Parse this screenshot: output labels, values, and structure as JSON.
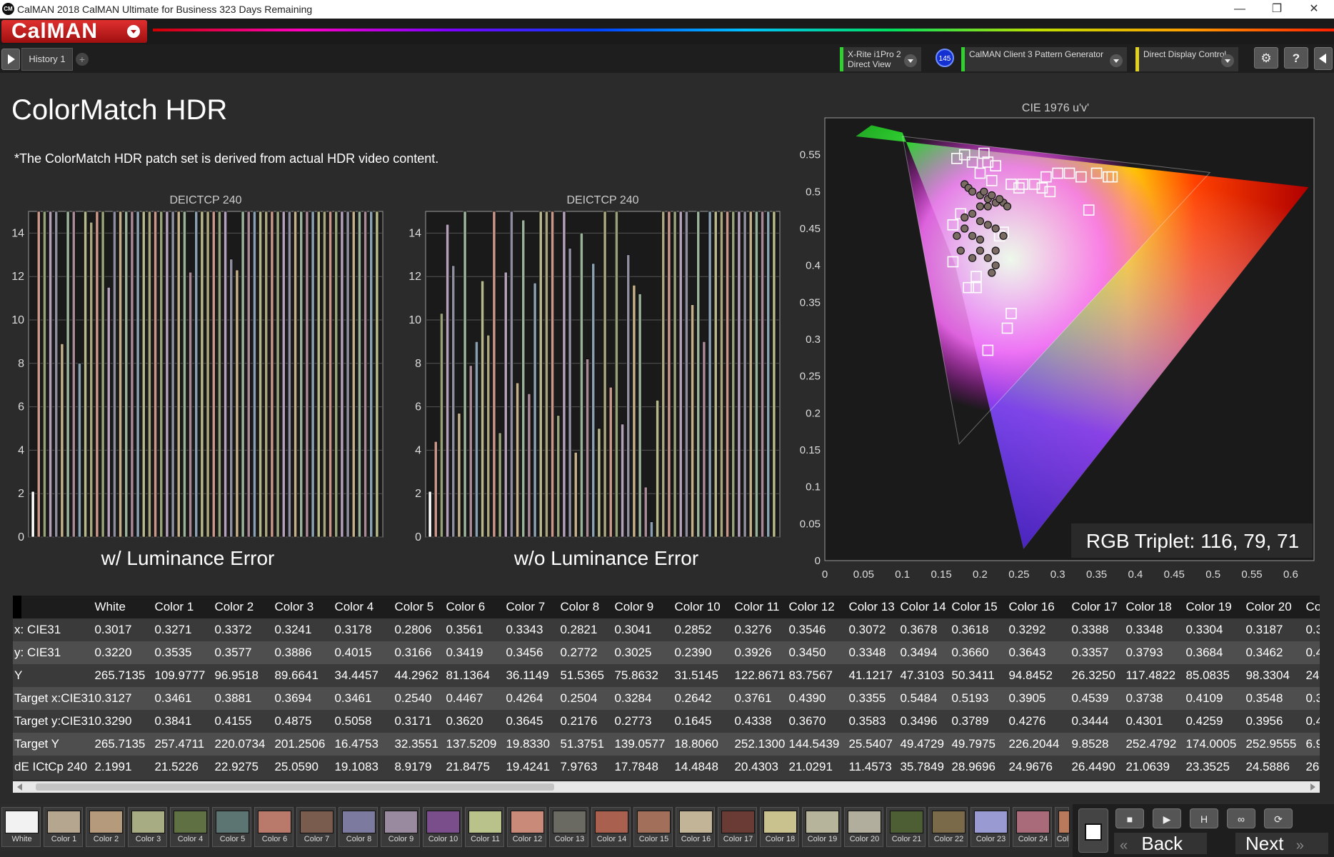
{
  "window": {
    "title": "CalMAN 2018 CalMAN Ultimate for Business 323 Days Remaining",
    "app_icon": "CM",
    "min": "—",
    "restore": "❐",
    "close": "✕"
  },
  "brand": {
    "logo": "CalMAN"
  },
  "toolbar": {
    "tab": "History 1",
    "add_tab": "+",
    "meter": {
      "line1": "X-Rite i1Pro 2",
      "line2": "Direct View"
    },
    "meter_badge": "145",
    "pattern_gen": "CalMAN Client 3 Pattern Generator",
    "display_ctrl": "Direct Display Control",
    "gear": "⚙",
    "help": "?"
  },
  "page": {
    "title": "ColorMatch HDR",
    "note": "*The ColorMatch HDR patch set is derived from actual HDR video content."
  },
  "chart_data": [
    {
      "type": "bar",
      "title": "DEICTCP 240",
      "caption": "w/ Luminance Error",
      "ylim": [
        0,
        15
      ],
      "yticks": [
        0,
        2,
        4,
        6,
        8,
        10,
        12,
        14
      ],
      "values": [
        2.1,
        21.5,
        22.9,
        25.1,
        19.1,
        8.9,
        21.8,
        19.4,
        8.0,
        17.8,
        14.5,
        20.4,
        21.0,
        11.5,
        35.8,
        29.0,
        25.0,
        26.4,
        21.1,
        23.4,
        24.6,
        22,
        24,
        26,
        21,
        30,
        18,
        12.2,
        19,
        25,
        22,
        21,
        27,
        24,
        12.8,
        12.3,
        20,
        23,
        21,
        22,
        28,
        19,
        22,
        24,
        23,
        25,
        18,
        22,
        24,
        21,
        26,
        20,
        23,
        25,
        22,
        19,
        24,
        21,
        23,
        20
      ]
    },
    {
      "type": "bar",
      "title": "DEICTCP 240",
      "caption": "w/o Luminance Error",
      "ylim": [
        0,
        15
      ],
      "yticks": [
        0,
        2,
        4,
        6,
        8,
        10,
        12,
        14
      ],
      "values": [
        2.1,
        4.4,
        10.3,
        14.4,
        12.5,
        5.7,
        16,
        7.9,
        9.0,
        11.8,
        9.3,
        20,
        4.8,
        12.2,
        20,
        7.1,
        14.6,
        6.6,
        11.7,
        18,
        20,
        17,
        5.6,
        15,
        13.3,
        3.9,
        14,
        8.2,
        12.6,
        5.0,
        16,
        6.9,
        19,
        5.2,
        13,
        11.6,
        11.2,
        2.3,
        0.7,
        6.3,
        20,
        18,
        22,
        19,
        16,
        10.7,
        21,
        9.0,
        20,
        22,
        17,
        25,
        21,
        19,
        23,
        20,
        18,
        24,
        22,
        21
      ]
    },
    {
      "type": "scatter",
      "title": "CIE 1976 u'v'",
      "xlim": [
        0,
        0.63
      ],
      "ylim": [
        0,
        0.6
      ],
      "xticks": [
        0,
        0.05,
        0.1,
        0.15,
        0.2,
        0.25,
        0.3,
        0.35,
        0.4,
        0.45,
        0.5,
        0.55,
        0.6
      ],
      "yticks": [
        0,
        0.05,
        0.1,
        0.15,
        0.2,
        0.25,
        0.3,
        0.35,
        0.4,
        0.45,
        0.5,
        0.55
      ],
      "xlabel": "",
      "ylabel": "",
      "gamut_outer": [
        [
          0.256,
          0.016
        ],
        [
          0.168,
          0.4
        ],
        [
          0.1,
          0.58
        ],
        [
          0.06,
          0.59
        ],
        [
          0.04,
          0.575
        ],
        [
          0.623,
          0.506
        ]
      ],
      "gamut_inner": [
        [
          0.173,
          0.158
        ],
        [
          0.1,
          0.575
        ],
        [
          0.496,
          0.526
        ]
      ],
      "targets": [
        [
          0.17,
          0.545
        ],
        [
          0.18,
          0.55
        ],
        [
          0.19,
          0.54
        ],
        [
          0.21,
          0.54
        ],
        [
          0.205,
          0.552
        ],
        [
          0.22,
          0.535
        ],
        [
          0.2,
          0.525
        ],
        [
          0.215,
          0.515
        ],
        [
          0.24,
          0.51
        ],
        [
          0.25,
          0.505
        ],
        [
          0.27,
          0.51
        ],
        [
          0.285,
          0.52
        ],
        [
          0.3,
          0.525
        ],
        [
          0.315,
          0.525
        ],
        [
          0.33,
          0.52
        ],
        [
          0.35,
          0.525
        ],
        [
          0.365,
          0.52
        ],
        [
          0.255,
          0.51
        ],
        [
          0.28,
          0.505
        ],
        [
          0.29,
          0.5
        ],
        [
          0.175,
          0.47
        ],
        [
          0.165,
          0.455
        ],
        [
          0.23,
          0.445
        ],
        [
          0.225,
          0.44
        ],
        [
          0.34,
          0.475
        ],
        [
          0.165,
          0.405
        ],
        [
          0.195,
          0.385
        ],
        [
          0.185,
          0.37
        ],
        [
          0.195,
          0.37
        ],
        [
          0.24,
          0.335
        ],
        [
          0.235,
          0.315
        ],
        [
          0.21,
          0.285
        ],
        [
          0.37,
          0.52
        ]
      ],
      "measured": [
        [
          0.18,
          0.51
        ],
        [
          0.185,
          0.505
        ],
        [
          0.19,
          0.5
        ],
        [
          0.2,
          0.495
        ],
        [
          0.205,
          0.5
        ],
        [
          0.21,
          0.49
        ],
        [
          0.215,
          0.495
        ],
        [
          0.22,
          0.485
        ],
        [
          0.23,
          0.485
        ],
        [
          0.235,
          0.48
        ],
        [
          0.2,
          0.48
        ],
        [
          0.21,
          0.48
        ],
        [
          0.225,
          0.49
        ],
        [
          0.19,
          0.47
        ],
        [
          0.18,
          0.465
        ],
        [
          0.2,
          0.46
        ],
        [
          0.21,
          0.455
        ],
        [
          0.22,
          0.45
        ],
        [
          0.18,
          0.45
        ],
        [
          0.19,
          0.44
        ],
        [
          0.17,
          0.44
        ],
        [
          0.2,
          0.435
        ],
        [
          0.23,
          0.44
        ],
        [
          0.19,
          0.41
        ],
        [
          0.21,
          0.41
        ],
        [
          0.22,
          0.4
        ],
        [
          0.215,
          0.39
        ],
        [
          0.2,
          0.42
        ],
        [
          0.175,
          0.42
        ],
        [
          0.22,
          0.42
        ]
      ],
      "annotation": "RGB Triplet: 116, 79, 71"
    }
  ],
  "table": {
    "columns": [
      "White",
      "Color 1",
      "Color 2",
      "Color 3",
      "Color 4",
      "Color 5",
      "Color 6",
      "Color 7",
      "Color 8",
      "Color 9",
      "Color 10",
      "Color 11",
      "Color 12",
      "Color 13",
      "Color 14",
      "Color 15",
      "Color 16",
      "Color 17",
      "Color 18",
      "Color 19",
      "Color 20",
      "Col"
    ],
    "rows": [
      {
        "label": "x: CIE31",
        "cells": [
          "0.3017",
          "0.3271",
          "0.3372",
          "0.3241",
          "0.3178",
          "0.2806",
          "0.3561",
          "0.3343",
          "0.2821",
          "0.3041",
          "0.2852",
          "0.3276",
          "0.3546",
          "0.3072",
          "0.3678",
          "0.3618",
          "0.3292",
          "0.3388",
          "0.3348",
          "0.3304",
          "0.3187",
          "0.3"
        ]
      },
      {
        "label": "y: CIE31",
        "cells": [
          "0.3220",
          "0.3535",
          "0.3577",
          "0.3886",
          "0.4015",
          "0.3166",
          "0.3419",
          "0.3456",
          "0.2772",
          "0.3025",
          "0.2390",
          "0.3926",
          "0.3450",
          "0.3348",
          "0.3494",
          "0.3660",
          "0.3643",
          "0.3357",
          "0.3793",
          "0.3684",
          "0.3462",
          "0.4"
        ]
      },
      {
        "label": "Y",
        "cells": [
          "265.7135",
          "109.9777",
          "96.9518",
          "89.6641",
          "34.4457",
          "44.2962",
          "81.1364",
          "36.1149",
          "51.5365",
          "75.8632",
          "31.5145",
          "122.8671",
          "83.7567",
          "41.1217",
          "47.3103",
          "50.3411",
          "94.8452",
          "26.3250",
          "117.4822",
          "85.0835",
          "98.3304",
          "24."
        ]
      },
      {
        "label": "Target x:CIE31",
        "cells": [
          "0.3127",
          "0.3461",
          "0.3881",
          "0.3694",
          "0.3461",
          "0.2540",
          "0.4467",
          "0.4264",
          "0.2504",
          "0.3284",
          "0.2642",
          "0.3761",
          "0.4390",
          "0.3355",
          "0.5484",
          "0.5193",
          "0.3905",
          "0.4539",
          "0.3738",
          "0.4109",
          "0.3548",
          "0.3"
        ]
      },
      {
        "label": "Target y:CIE31",
        "cells": [
          "0.3290",
          "0.3841",
          "0.4155",
          "0.4875",
          "0.5058",
          "0.3171",
          "0.3620",
          "0.3645",
          "0.2176",
          "0.2773",
          "0.1645",
          "0.4338",
          "0.3670",
          "0.3583",
          "0.3496",
          "0.3789",
          "0.4276",
          "0.3444",
          "0.4301",
          "0.4259",
          "0.3956",
          "0.4"
        ]
      },
      {
        "label": "Target Y",
        "cells": [
          "265.7135",
          "257.4711",
          "220.0734",
          "201.2506",
          "16.4753",
          "32.3551",
          "137.5209",
          "19.8330",
          "51.3751",
          "139.0577",
          "18.8060",
          "252.1300",
          "144.5439",
          "25.5407",
          "49.4729",
          "49.7975",
          "226.2044",
          "9.8528",
          "252.4792",
          "174.0005",
          "252.9555",
          "6.9"
        ]
      },
      {
        "label": "dE ICtCp 240",
        "cells": [
          "2.1991",
          "21.5226",
          "22.9275",
          "25.0590",
          "19.1083",
          "8.9179",
          "21.8475",
          "19.4241",
          "7.9763",
          "17.7848",
          "14.4848",
          "20.4303",
          "21.0291",
          "11.4573",
          "35.7849",
          "28.9696",
          "24.9676",
          "26.4490",
          "21.0639",
          "23.3525",
          "24.5886",
          "26."
        ]
      }
    ]
  },
  "patches": [
    {
      "label": "White",
      "color": "#f2f2f2"
    },
    {
      "label": "Color 1",
      "color": "#b5a78f"
    },
    {
      "label": "Color 2",
      "color": "#b59a7c"
    },
    {
      "label": "Color 3",
      "color": "#a7ac82"
    },
    {
      "label": "Color 4",
      "color": "#5f7143"
    },
    {
      "label": "Color 5",
      "color": "#5c7472"
    },
    {
      "label": "Color 6",
      "color": "#b97a6c"
    },
    {
      "label": "Color 7",
      "color": "#7a5c4e"
    },
    {
      "label": "Color 8",
      "color": "#7d7aa0"
    },
    {
      "label": "Color 9",
      "color": "#9a8aa0"
    },
    {
      "label": "Color 10",
      "color": "#7a4e8a"
    },
    {
      "label": "Color 11",
      "color": "#b9c28a"
    },
    {
      "label": "Color 12",
      "color": "#c98a7a"
    },
    {
      "label": "Color 13",
      "color": "#6a6a62"
    },
    {
      "label": "Color 14",
      "color": "#a9604e"
    },
    {
      "label": "Color 15",
      "color": "#a2705a"
    },
    {
      "label": "Color 16",
      "color": "#c2b496"
    },
    {
      "label": "Color 17",
      "color": "#6a3a34"
    },
    {
      "label": "Color 18",
      "color": "#c9c28e"
    },
    {
      "label": "Color 19",
      "color": "#b6b49a"
    },
    {
      "label": "Color 20",
      "color": "#b2ae9e"
    },
    {
      "label": "Color 21",
      "color": "#4e5e34"
    },
    {
      "label": "Color 22",
      "color": "#7a6a4a"
    },
    {
      "label": "Color 23",
      "color": "#9a9ad2"
    },
    {
      "label": "Color 24",
      "color": "#a96a7a"
    },
    {
      "label": "Col",
      "color": "#b87a5a"
    }
  ],
  "controls": {
    "back": "Back",
    "next": "Next",
    "stop": "■",
    "play": "▶",
    "save": "H",
    "loop": "∞",
    "record": "■"
  },
  "colors": {
    "bar_palette": [
      "#a9a57e",
      "#c9968a",
      "#98a27a",
      "#b4a0b8",
      "#8e8e9e",
      "#c3b08a",
      "#9ab29a",
      "#a88a96",
      "#8aa0b0",
      "#b6b88c"
    ]
  }
}
